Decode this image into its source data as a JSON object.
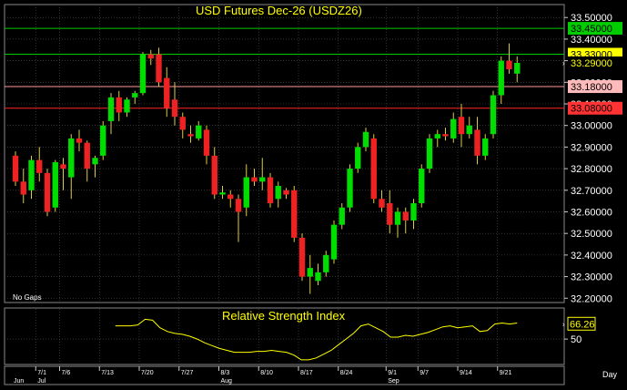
{
  "main_title": "USD Futures Dec-26 (USDZ26)",
  "rsi_title": "Relative Strength Index",
  "note": "No Gaps",
  "axis_unit_label": "Day",
  "rsi_current_label": "66.26",
  "rsi_tick_label": "50",
  "colors": {
    "up": "#00dd00",
    "down": "#ee2222",
    "background": "#000000",
    "grid": "#555555",
    "rsi_line": "#ffff00",
    "title": "#ffff00"
  },
  "chart_data": [
    {
      "type": "candlestick",
      "title": "USD Futures Dec-26 (USDZ26)",
      "ylim": [
        32.18,
        33.56
      ],
      "y_ticks": [
        "33.50000",
        "33.40000",
        "33.30000",
        "33.20000",
        "33.10000",
        "33.00000",
        "32.90000",
        "32.80000",
        "32.70000",
        "32.60000",
        "32.50000",
        "32.40000",
        "32.30000",
        "32.20000"
      ],
      "y_tick_values": [
        33.5,
        33.4,
        33.3,
        33.2,
        33.1,
        33.0,
        32.9,
        32.8,
        32.7,
        32.6,
        32.5,
        32.4,
        32.3,
        32.2
      ],
      "x_labels": [
        {
          "label": "7/1",
          "index": 3
        },
        {
          "label": "7/6",
          "index": 6
        },
        {
          "label": "7/13",
          "index": 11
        },
        {
          "label": "7/20",
          "index": 16
        },
        {
          "label": "7/27",
          "index": 21
        },
        {
          "label": "8/3",
          "index": 26
        },
        {
          "label": "8/10",
          "index": 31
        },
        {
          "label": "8/17",
          "index": 36
        },
        {
          "label": "8/24",
          "index": 41
        },
        {
          "label": "9/1",
          "index": 47
        },
        {
          "label": "9/7",
          "index": 51
        },
        {
          "label": "9/14",
          "index": 56
        },
        {
          "label": "9/21",
          "index": 61
        }
      ],
      "month_labels": [
        {
          "label": "Jun",
          "index": 0
        },
        {
          "label": "Jul",
          "index": 3
        },
        {
          "label": "Aug",
          "index": 26
        },
        {
          "label": "Sep",
          "index": 47
        }
      ],
      "horizontal_lines": [
        {
          "value": 33.45,
          "label": "33.45000",
          "color": "#00cc00",
          "label_bg": "#00cc00",
          "label_color": "#000000"
        },
        {
          "value": 33.33,
          "label": "33.33000",
          "color": "#00cc00",
          "label_bg": "#ffff00",
          "label_color": "#000000"
        },
        {
          "value": 33.18,
          "label": "33.18000",
          "color": "#ff9999",
          "label_bg": "#ffbbbb",
          "label_color": "#000000"
        },
        {
          "value": 33.08,
          "label": "33.08000",
          "color": "#ff2222",
          "label_bg": "#ff3333",
          "label_color": "#000000"
        }
      ],
      "last_price_label": "33.29000",
      "last_price": 33.29,
      "candles": [
        {
          "o": 32.86,
          "h": 32.88,
          "l": 32.72,
          "c": 32.74
        },
        {
          "o": 32.74,
          "h": 32.8,
          "l": 32.64,
          "c": 32.68
        },
        {
          "o": 32.7,
          "h": 32.86,
          "l": 32.66,
          "c": 32.84
        },
        {
          "o": 32.84,
          "h": 32.9,
          "l": 32.74,
          "c": 32.78
        },
        {
          "o": 32.78,
          "h": 32.8,
          "l": 32.58,
          "c": 32.6
        },
        {
          "o": 32.62,
          "h": 32.84,
          "l": 32.6,
          "c": 32.83
        },
        {
          "o": 32.82,
          "h": 32.85,
          "l": 32.7,
          "c": 32.8
        },
        {
          "o": 32.76,
          "h": 32.96,
          "l": 32.66,
          "c": 32.94
        },
        {
          "o": 32.94,
          "h": 32.98,
          "l": 32.88,
          "c": 32.92
        },
        {
          "o": 32.92,
          "h": 32.93,
          "l": 32.74,
          "c": 32.8
        },
        {
          "o": 32.82,
          "h": 32.86,
          "l": 32.76,
          "c": 32.85
        },
        {
          "o": 32.86,
          "h": 33.02,
          "l": 32.84,
          "c": 33.0
        },
        {
          "o": 33.02,
          "h": 33.15,
          "l": 32.96,
          "c": 33.13
        },
        {
          "o": 33.13,
          "h": 33.16,
          "l": 33.02,
          "c": 33.06
        },
        {
          "o": 33.06,
          "h": 33.13,
          "l": 33.04,
          "c": 33.12
        },
        {
          "o": 33.13,
          "h": 33.16,
          "l": 33.1,
          "c": 33.15
        },
        {
          "o": 33.15,
          "h": 33.34,
          "l": 33.14,
          "c": 33.33
        },
        {
          "o": 33.33,
          "h": 33.35,
          "l": 33.28,
          "c": 33.31
        },
        {
          "o": 33.33,
          "h": 33.36,
          "l": 33.18,
          "c": 33.2
        },
        {
          "o": 33.22,
          "h": 33.27,
          "l": 33.04,
          "c": 33.08
        },
        {
          "o": 33.12,
          "h": 33.2,
          "l": 33.0,
          "c": 33.04
        },
        {
          "o": 33.04,
          "h": 33.06,
          "l": 32.94,
          "c": 32.98
        },
        {
          "o": 32.96,
          "h": 33.0,
          "l": 32.92,
          "c": 32.95
        },
        {
          "o": 32.94,
          "h": 33.02,
          "l": 32.93,
          "c": 33.0
        },
        {
          "o": 32.98,
          "h": 33.0,
          "l": 32.82,
          "c": 32.86
        },
        {
          "o": 32.86,
          "h": 32.9,
          "l": 32.66,
          "c": 32.68
        },
        {
          "o": 32.68,
          "h": 32.72,
          "l": 32.66,
          "c": 32.69
        },
        {
          "o": 32.68,
          "h": 32.7,
          "l": 32.62,
          "c": 32.66
        },
        {
          "o": 32.66,
          "h": 32.68,
          "l": 32.46,
          "c": 32.6
        },
        {
          "o": 32.62,
          "h": 32.82,
          "l": 32.58,
          "c": 32.76
        },
        {
          "o": 32.76,
          "h": 32.8,
          "l": 32.72,
          "c": 32.74
        },
        {
          "o": 32.74,
          "h": 32.85,
          "l": 32.7,
          "c": 32.76
        },
        {
          "o": 32.76,
          "h": 32.78,
          "l": 32.62,
          "c": 32.64
        },
        {
          "o": 32.66,
          "h": 32.74,
          "l": 32.62,
          "c": 32.72
        },
        {
          "o": 32.7,
          "h": 32.71,
          "l": 32.66,
          "c": 32.68
        },
        {
          "o": 32.7,
          "h": 32.72,
          "l": 32.46,
          "c": 32.48
        },
        {
          "o": 32.48,
          "h": 32.5,
          "l": 32.28,
          "c": 32.3
        },
        {
          "o": 32.3,
          "h": 32.4,
          "l": 32.22,
          "c": 32.34
        },
        {
          "o": 32.28,
          "h": 32.36,
          "l": 32.26,
          "c": 32.32
        },
        {
          "o": 32.32,
          "h": 32.42,
          "l": 32.3,
          "c": 32.4
        },
        {
          "o": 32.38,
          "h": 32.56,
          "l": 32.36,
          "c": 32.54
        },
        {
          "o": 32.54,
          "h": 32.64,
          "l": 32.52,
          "c": 32.62
        },
        {
          "o": 32.62,
          "h": 32.82,
          "l": 32.6,
          "c": 32.8
        },
        {
          "o": 32.8,
          "h": 32.92,
          "l": 32.78,
          "c": 32.9
        },
        {
          "o": 32.9,
          "h": 32.99,
          "l": 32.88,
          "c": 32.97
        },
        {
          "o": 32.94,
          "h": 32.96,
          "l": 32.64,
          "c": 32.66
        },
        {
          "o": 32.66,
          "h": 32.7,
          "l": 32.6,
          "c": 32.62
        },
        {
          "o": 32.64,
          "h": 32.7,
          "l": 32.5,
          "c": 32.54
        },
        {
          "o": 32.54,
          "h": 32.62,
          "l": 32.48,
          "c": 32.6
        },
        {
          "o": 32.6,
          "h": 32.62,
          "l": 32.5,
          "c": 32.56
        },
        {
          "o": 32.56,
          "h": 32.66,
          "l": 32.52,
          "c": 32.64
        },
        {
          "o": 32.64,
          "h": 32.82,
          "l": 32.62,
          "c": 32.8
        },
        {
          "o": 32.8,
          "h": 32.96,
          "l": 32.78,
          "c": 32.94
        },
        {
          "o": 32.94,
          "h": 32.98,
          "l": 32.9,
          "c": 32.96
        },
        {
          "o": 32.96,
          "h": 32.99,
          "l": 32.93,
          "c": 32.95
        },
        {
          "o": 32.94,
          "h": 33.06,
          "l": 32.92,
          "c": 33.03
        },
        {
          "o": 33.04,
          "h": 33.1,
          "l": 32.9,
          "c": 32.96
        },
        {
          "o": 32.96,
          "h": 33.04,
          "l": 32.94,
          "c": 33.0
        },
        {
          "o": 32.98,
          "h": 33.04,
          "l": 32.82,
          "c": 32.86
        },
        {
          "o": 32.86,
          "h": 32.96,
          "l": 32.84,
          "c": 32.94
        },
        {
          "o": 32.96,
          "h": 33.16,
          "l": 32.94,
          "c": 33.14
        },
        {
          "o": 33.14,
          "h": 33.32,
          "l": 33.1,
          "c": 33.3
        },
        {
          "o": 33.3,
          "h": 33.38,
          "l": 33.24,
          "c": 33.26
        },
        {
          "o": 33.24,
          "h": 33.32,
          "l": 33.2,
          "c": 33.29
        }
      ]
    },
    {
      "type": "line",
      "title": "Relative Strength Index",
      "ylim": [
        24,
        82
      ],
      "y_ticks": [
        50
      ],
      "current": 66.26,
      "start_index": 13,
      "values": [
        64,
        64,
        64,
        65,
        71,
        70,
        62,
        58,
        56,
        55,
        53,
        50,
        46,
        43,
        40,
        38,
        36,
        36,
        36,
        37,
        37,
        38,
        37,
        36,
        33,
        28,
        28,
        30,
        34,
        38,
        44,
        50,
        56,
        64,
        66,
        62,
        58,
        52,
        52,
        54,
        53,
        55,
        57,
        60,
        63,
        64,
        62,
        63,
        64,
        58,
        59,
        66,
        67,
        66,
        67
      ]
    }
  ]
}
